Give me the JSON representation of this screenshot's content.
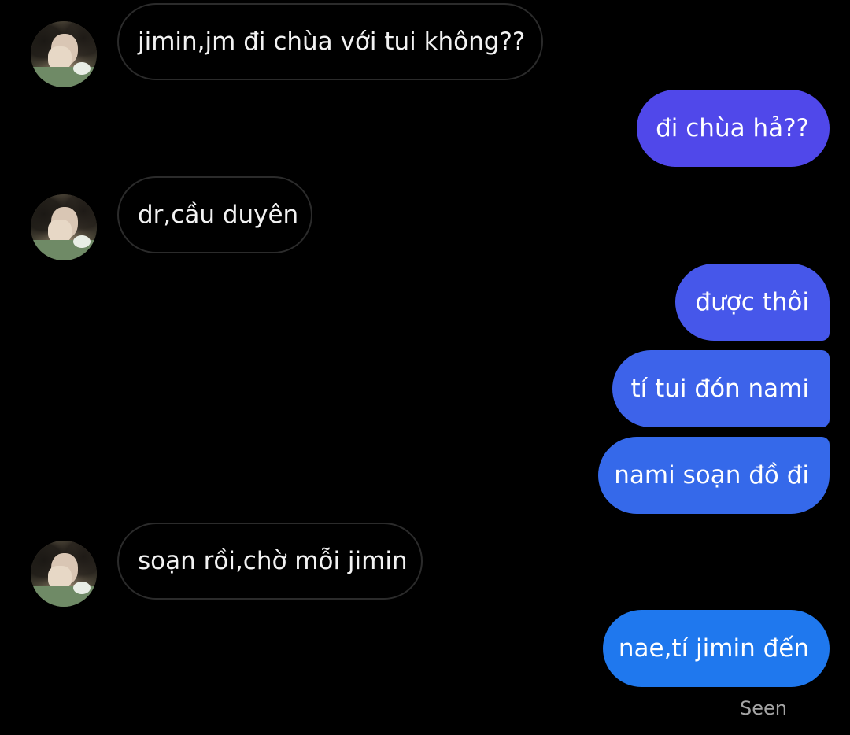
{
  "messages": [
    {
      "id": "m1",
      "from": "them",
      "text": "jimin,jm đi chùa với tui không??"
    },
    {
      "id": "m2",
      "from": "me",
      "text": "đi chùa hả??",
      "color": "#5048ea"
    },
    {
      "id": "m3",
      "from": "them",
      "text": "dr,cầu duyên"
    },
    {
      "id": "m4",
      "from": "me",
      "text": "được thôi",
      "color": "#4657ea"
    },
    {
      "id": "m5",
      "from": "me",
      "text": "tí tui đón nami",
      "color": "#3d63ea"
    },
    {
      "id": "m6",
      "from": "me",
      "text": "nami soạn đồ đi",
      "color": "#3569ea"
    },
    {
      "id": "m7",
      "from": "them",
      "text": "soạn rồi,chờ mỗi jimin"
    },
    {
      "id": "m8",
      "from": "me",
      "text": "nae,tí jimin đến",
      "color": "#1f78ee"
    }
  ],
  "status": {
    "seen_label": "Seen"
  },
  "colors": {
    "background": "#000000",
    "incoming_border": "#2b2b2b",
    "incoming_text": "#f2f2f2",
    "outgoing_text": "#ffffff",
    "seen_text": "#a4a4a4"
  },
  "avatar": {
    "icon": "profile-photo-icon"
  }
}
